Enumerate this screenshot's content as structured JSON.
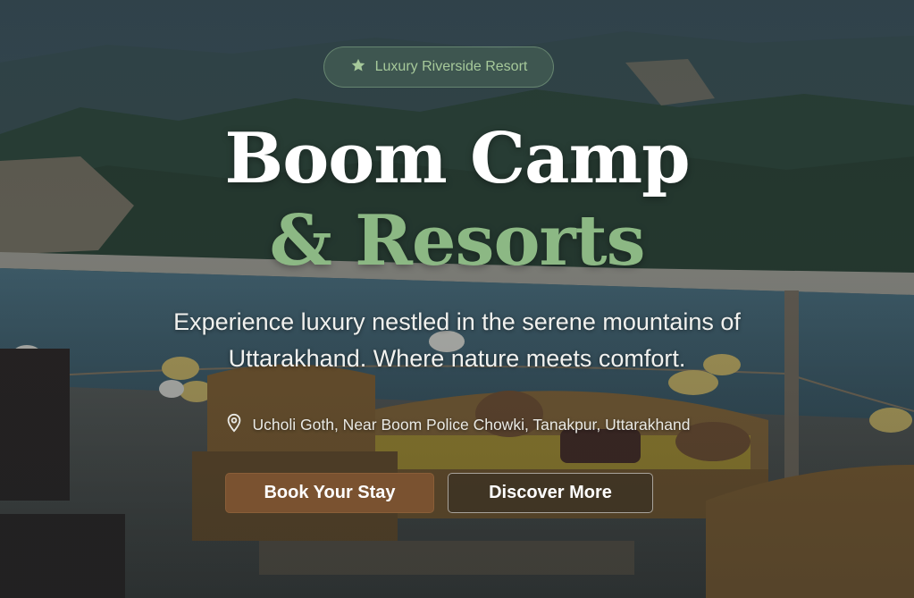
{
  "hero": {
    "badge": {
      "icon": "star-icon",
      "label": "Luxury Riverside Resort"
    },
    "title_line1": "Boom Camp",
    "title_line2": "& Resorts",
    "subtitle": "Experience luxury nestled in the serene mountains of Uttarakhand. Where nature meets comfort.",
    "location": {
      "icon": "map-pin-icon",
      "text": "Ucholi Goth, Near Boom Police Chowki, Tanakpur, Uttarakhand"
    },
    "primary_button": "Book Your Stay",
    "secondary_button": "Discover More"
  },
  "colors": {
    "accent_green": "#8cb884",
    "button_brown": "#7a5230"
  }
}
